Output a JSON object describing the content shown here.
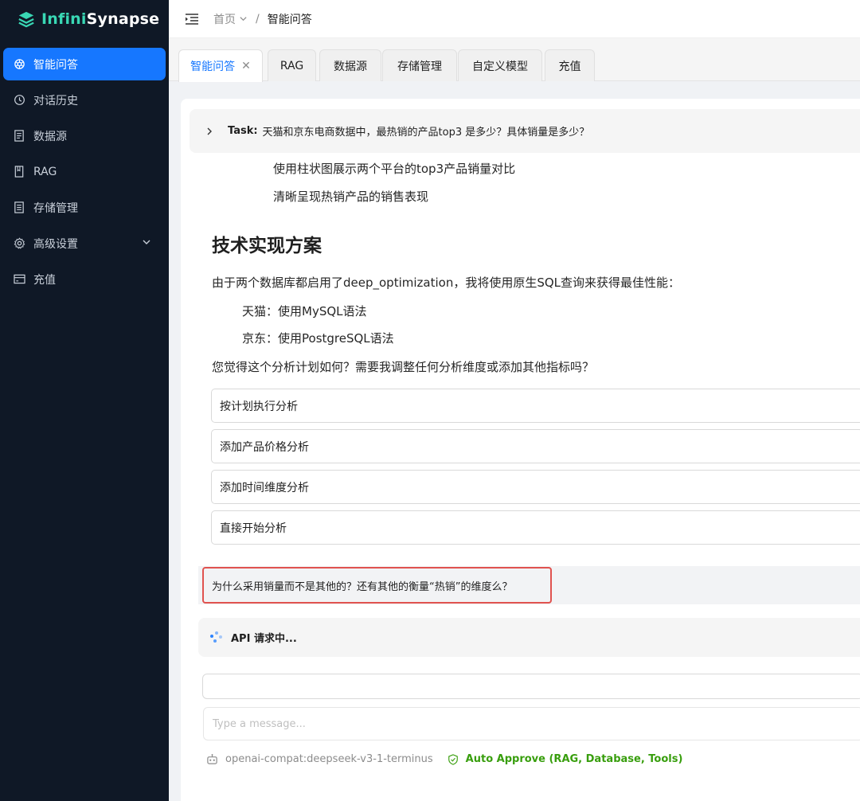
{
  "brand": {
    "name_part1": "Infini",
    "name_part2": "Synapse",
    "accent": "#39d7b4"
  },
  "sidebar": {
    "items": [
      {
        "label": "智能问答",
        "icon": "openai-icon",
        "active": true
      },
      {
        "label": "对话历史",
        "icon": "clock-icon"
      },
      {
        "label": "数据源",
        "icon": "document-icon"
      },
      {
        "label": "RAG",
        "icon": "book-icon"
      },
      {
        "label": "存储管理",
        "icon": "storage-icon"
      },
      {
        "label": "高级设置",
        "icon": "settings-icon",
        "has_submenu": true
      },
      {
        "label": "充值",
        "icon": "card-icon"
      }
    ]
  },
  "header": {
    "breadcrumb_home": "首页",
    "breadcrumb_current": "智能问答"
  },
  "tabs": [
    {
      "label": "智能问答",
      "active": true,
      "closable": true
    },
    {
      "label": "RAG"
    },
    {
      "label": "数据源"
    },
    {
      "label": "存储管理"
    },
    {
      "label": "自定义模型"
    },
    {
      "label": "充值"
    }
  ],
  "chat": {
    "task_label": "Task:",
    "task_text": "天猫和京东电商数据中，最热销的产品top3 是多少？具体销量是多少？",
    "bullets": [
      "使用柱状图展示两个平台的top3产品销量对比",
      "清晰呈现热销产品的销售表现"
    ],
    "heading": "技术实现方案",
    "para1": "由于两个数据库都启用了deep_optimization，我将使用原生SQL查询来获得最佳性能：",
    "sub_items": [
      "天猫：使用MySQL语法",
      "京东：使用PostgreSQL语法"
    ],
    "question": "您觉得这个分析计划如何？需要我调整任何分析维度或添加其他指标吗？",
    "options": [
      "按计划执行分析",
      "添加产品价格分析",
      "添加时间维度分析",
      "直接开始分析"
    ],
    "user_message": "为什么采用销量而不是其他的？还有其他的衡量“热销”的维度么？",
    "status": "API 请求中..."
  },
  "composer": {
    "input_value": "",
    "placeholder": "Type a message..."
  },
  "footer": {
    "model": "openai-compat:deepseek-v3-1-terminus",
    "auto_approve": "Auto Approve (RAG, Database, Tools)"
  },
  "colors": {
    "primary": "#1677ff",
    "sidebar_bg": "#0f1826",
    "highlight_border": "#e0524f",
    "approve": "#389e0d"
  }
}
